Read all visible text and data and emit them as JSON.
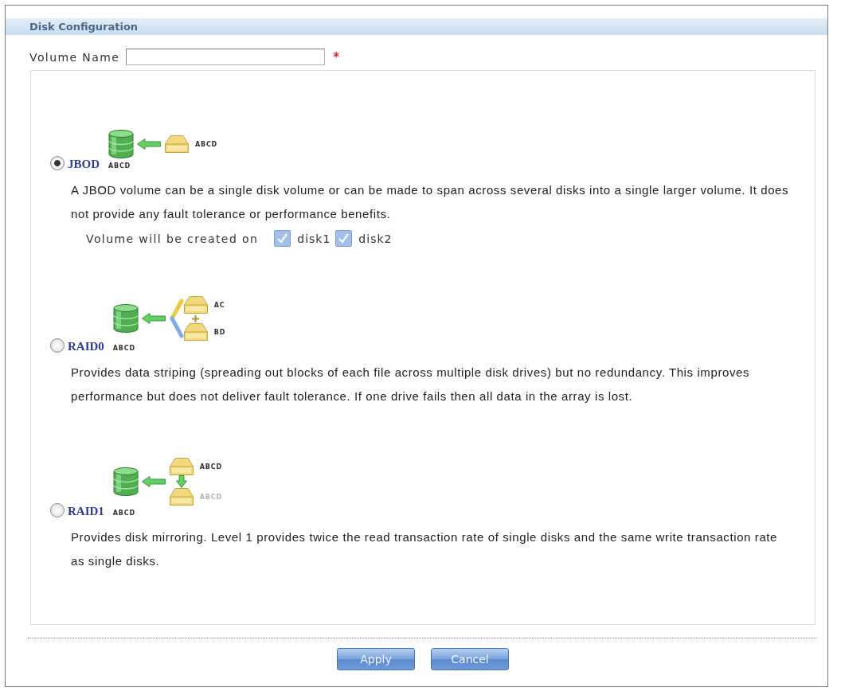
{
  "section": {
    "title": "Disk Configuration"
  },
  "volume_name": {
    "label": "Volume Name",
    "required_mark": "*"
  },
  "options": [
    {
      "kind": "jbod",
      "label": "JBOD",
      "selected": true,
      "volume_label": "ABCD",
      "disks": [
        {
          "label": "ABCD",
          "faded": false
        }
      ],
      "description": "A JBOD volume can be a single disk volume or can be made to span across several disks into a single larger volume. It does not provide any fault tolerance or performance benefits.",
      "placement": {
        "label": "Volume will be created on",
        "disks": [
          {
            "label": "disk1",
            "checked": true
          },
          {
            "label": "disk2",
            "checked": true
          }
        ]
      }
    },
    {
      "kind": "raid0",
      "label": "RAID0",
      "selected": false,
      "volume_label": "ABCD",
      "disks": [
        {
          "label": "AC",
          "faded": false
        },
        {
          "label": "BD",
          "faded": false
        }
      ],
      "description": "Provides data striping (spreading out blocks of each file across multiple disk drives) but no redundancy. This improves performance but does not deliver fault tolerance. If one drive fails then all data in the array is lost."
    },
    {
      "kind": "raid1",
      "label": "RAID1",
      "selected": false,
      "volume_label": "ABCD",
      "disks": [
        {
          "label": "ABCD",
          "faded": false
        },
        {
          "label": "ABCD",
          "faded": true
        }
      ],
      "description": "Provides disk mirroring. Level 1 provides twice the read transaction rate of single disks and the same write transaction rate as single disks."
    }
  ],
  "buttons": [
    {
      "label": "Apply"
    },
    {
      "label": "Cancel"
    }
  ]
}
